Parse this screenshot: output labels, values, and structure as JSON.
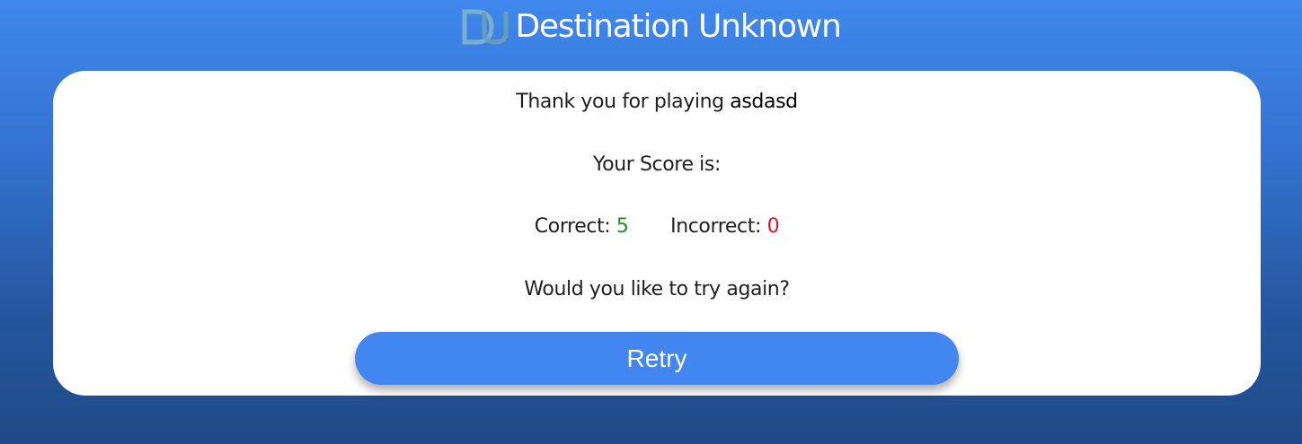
{
  "header": {
    "logo_icon": "du-logo-icon",
    "title": "Destination Unknown"
  },
  "result": {
    "thanks_text": "Thank you for playing",
    "player_name": "asdasd",
    "score_heading": "Your Score is:",
    "correct_label": "Correct:",
    "correct_value": "5",
    "incorrect_label": "Incorrect:",
    "incorrect_value": "0",
    "retry_question": "Would you like to try again?",
    "retry_button_label": "Retry"
  },
  "colors": {
    "background_top": "#4088ee",
    "background_bottom": "#1f4a86",
    "button": "#4287ef",
    "correct": "#2a8a2a",
    "incorrect": "#e0182d"
  }
}
